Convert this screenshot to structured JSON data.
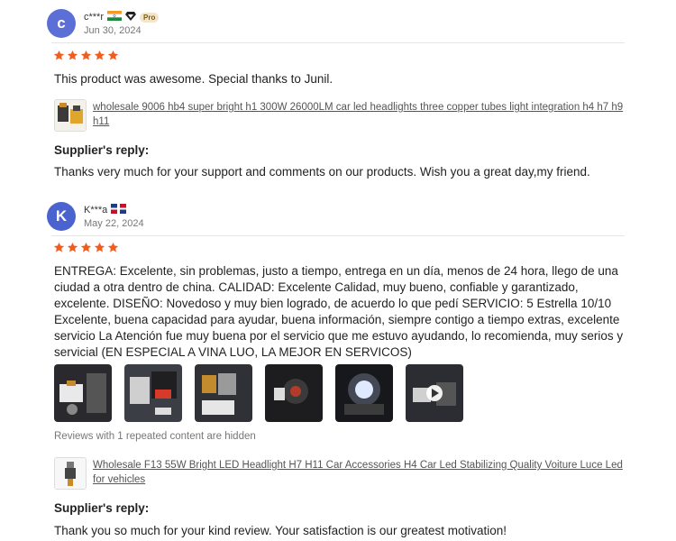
{
  "reviews": [
    {
      "avatar_letter": "c",
      "avatar_color": "#5b6fd6",
      "username": "c***r",
      "flag": "india",
      "badge": "Pro",
      "date": "Jun 30, 2024",
      "rating": 5,
      "text": "This product was awesome. Special thanks to Junil.",
      "product_title": "wholesale 9006 hb4 super bright h1 300W 26000LM car led headlights three copper tubes light integration h4 h7 h9 h11",
      "reply_heading": "Supplier's reply:",
      "reply_text": "Thanks very much for your support and comments on our products. Wish you a great day,my friend."
    },
    {
      "avatar_letter": "K",
      "avatar_color": "#4b63cf",
      "username": "K***a",
      "flag": "dominican-republic",
      "date": "May 22, 2024",
      "rating": 5,
      "text": "ENTREGA: Excelente, sin problemas, justo a tiempo, entrega en un día, menos de 24 hora, llego de una ciudad a otra dentro de china. CALIDAD: Excelente Calidad, muy bueno, confiable y garantizado, excelente. DISEÑO: Novedoso y muy bien logrado, de acuerdo lo que pedí SERVICIO: 5 Estrella 10/10 Excelente, buena capacidad para ayudar, buena información, siempre contigo a tiempo extras, excelente servicio La Atención fue muy buena por el servicio que me estuvo ayudando, lo recomienda, muy serios y servicial (EN ESPECIAL A VINA LUO, LA MEJOR EN SERVICOS)",
      "photos": [
        "photo-1",
        "photo-2",
        "photo-3",
        "photo-4",
        "photo-5",
        "video-6"
      ],
      "hidden_note": "Reviews with 1 repeated content are hidden",
      "product_title": "Wholesale F13 55W Bright LED Headlight H7 H11 Car Accessories H4 Car Led Stabilizing Quality Voiture Luce Led for vehicles",
      "reply_heading": "Supplier's reply:",
      "reply_text": "Thank you so much for your kind review. Your satisfaction is our greatest motivation!"
    }
  ],
  "colors": {
    "star": "#f25c1f",
    "pro_badge": "#f3e6c8"
  }
}
